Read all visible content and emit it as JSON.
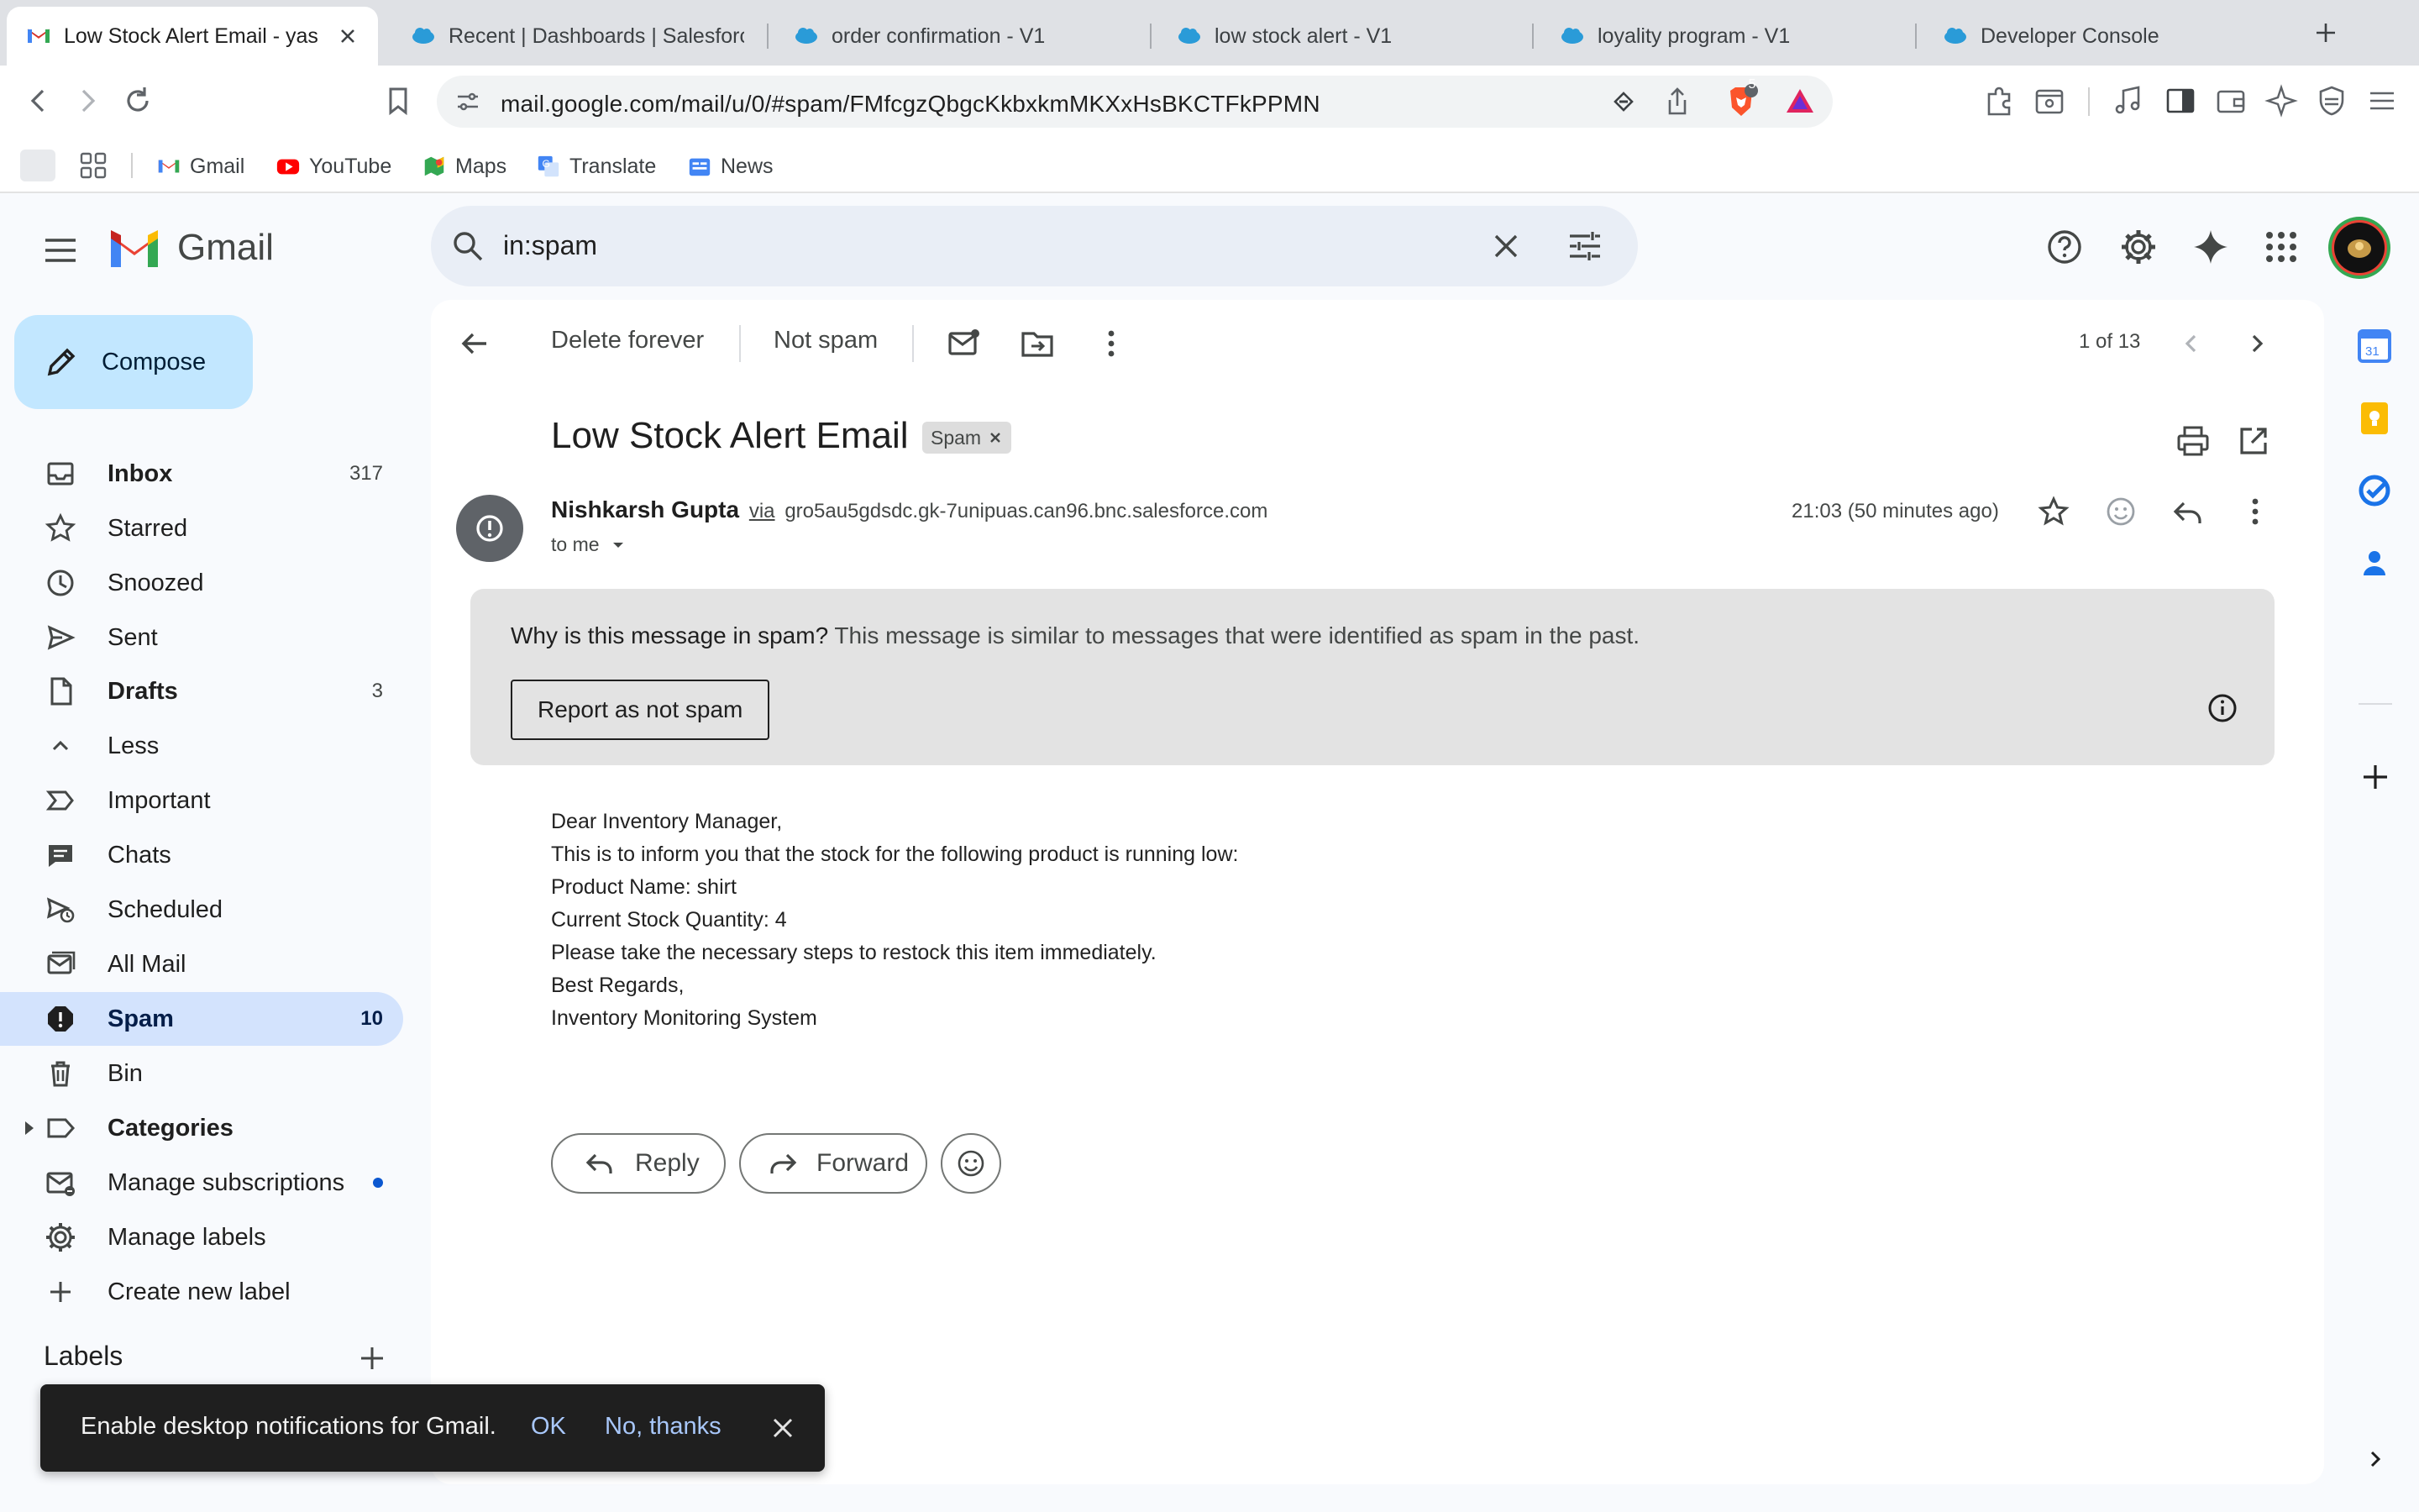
{
  "browser": {
    "tabs": [
      {
        "title": "Low Stock Alert Email - yas",
        "favicon": "gmail-icon",
        "active": true
      },
      {
        "title": "Recent | Dashboards | Salesforc",
        "favicon": "salesforce-cloud-icon"
      },
      {
        "title": "order confirmation - V1",
        "favicon": "salesforce-cloud-icon"
      },
      {
        "title": "low stock alert - V1",
        "favicon": "salesforce-cloud-icon"
      },
      {
        "title": "loyality program - V1",
        "favicon": "salesforce-cloud-icon"
      },
      {
        "title": "Developer Console",
        "favicon": "salesforce-cloud-icon"
      }
    ],
    "url": "mail.google.com/mail/u/0/#spam/FMfcgzQbgcKkbxkmMKXxHsBKCTFkPPMN",
    "brave_badge": "5",
    "bookmarks": [
      {
        "label": "Gmail",
        "icon": "gmail-icon"
      },
      {
        "label": "YouTube",
        "icon": "youtube-icon"
      },
      {
        "label": "Maps",
        "icon": "maps-icon"
      },
      {
        "label": "Translate",
        "icon": "translate-icon"
      },
      {
        "label": "News",
        "icon": "news-icon"
      }
    ]
  },
  "gmail": {
    "brand": "Gmail",
    "search_query": "in:spam",
    "compose_label": "Compose",
    "nav": [
      {
        "label": "Inbox",
        "count": "317",
        "icon": "inbox-icon",
        "bold": true
      },
      {
        "label": "Starred",
        "count": "",
        "icon": "star-icon"
      },
      {
        "label": "Snoozed",
        "count": "",
        "icon": "clock-icon"
      },
      {
        "label": "Sent",
        "count": "",
        "icon": "send-icon"
      },
      {
        "label": "Drafts",
        "count": "3",
        "icon": "draft-icon",
        "bold": true
      },
      {
        "label": "Less",
        "count": "",
        "icon": "chevron-up-icon"
      },
      {
        "label": "Important",
        "count": "",
        "icon": "important-icon"
      },
      {
        "label": "Chats",
        "count": "",
        "icon": "chat-icon"
      },
      {
        "label": "Scheduled",
        "count": "",
        "icon": "scheduled-icon"
      },
      {
        "label": "All Mail",
        "count": "",
        "icon": "all-mail-icon"
      },
      {
        "label": "Spam",
        "count": "10",
        "icon": "spam-icon",
        "selected": true
      },
      {
        "label": "Bin",
        "count": "",
        "icon": "trash-icon"
      },
      {
        "label": "Categories",
        "count": "",
        "icon": "label-icon",
        "bold": true
      },
      {
        "label": "Manage subscriptions",
        "count": "",
        "icon": "subscriptions-icon"
      },
      {
        "label": "Manage labels",
        "count": "",
        "icon": "gear-icon"
      },
      {
        "label": "Create new label",
        "count": "",
        "icon": "plus-icon"
      }
    ],
    "labels_heading": "Labels",
    "toolbar": {
      "delete_forever": "Delete forever",
      "not_spam": "Not spam",
      "pagination": "1 of 13"
    },
    "email": {
      "subject": "Low Stock Alert Email",
      "chip": "Spam",
      "sender_name": "Nishkarsh Gupta",
      "via": "via",
      "sender_domain": "gro5au5gdsdc.gk-7unipuas.can96.bnc.salesforce.com",
      "to": "to me",
      "time": "21:03 (50 minutes ago)",
      "spam_question": "Why is this message in spam?",
      "spam_reason": "This message is similar to messages that were identified as spam in the past.",
      "report_button": "Report as not spam",
      "body_lines": [
        "Dear Inventory Manager,",
        "This is to inform you that the stock for the following product is running low:",
        "Product Name: shirt",
        "Current Stock Quantity: 4",
        "Please take the necessary steps to restock this item immediately.",
        "Best Regards,",
        "Inventory Monitoring System"
      ],
      "reply_label": "Reply",
      "forward_label": "Forward"
    },
    "snackbar": {
      "message": "Enable desktop notifications for Gmail.",
      "ok": "OK",
      "no_thanks": "No, thanks"
    },
    "colors": {
      "selected_nav": "#d3e3fd",
      "compose": "#c2e7ff",
      "search_bg": "#e9eef6",
      "snackbar_link": "#a8c7fa"
    }
  }
}
